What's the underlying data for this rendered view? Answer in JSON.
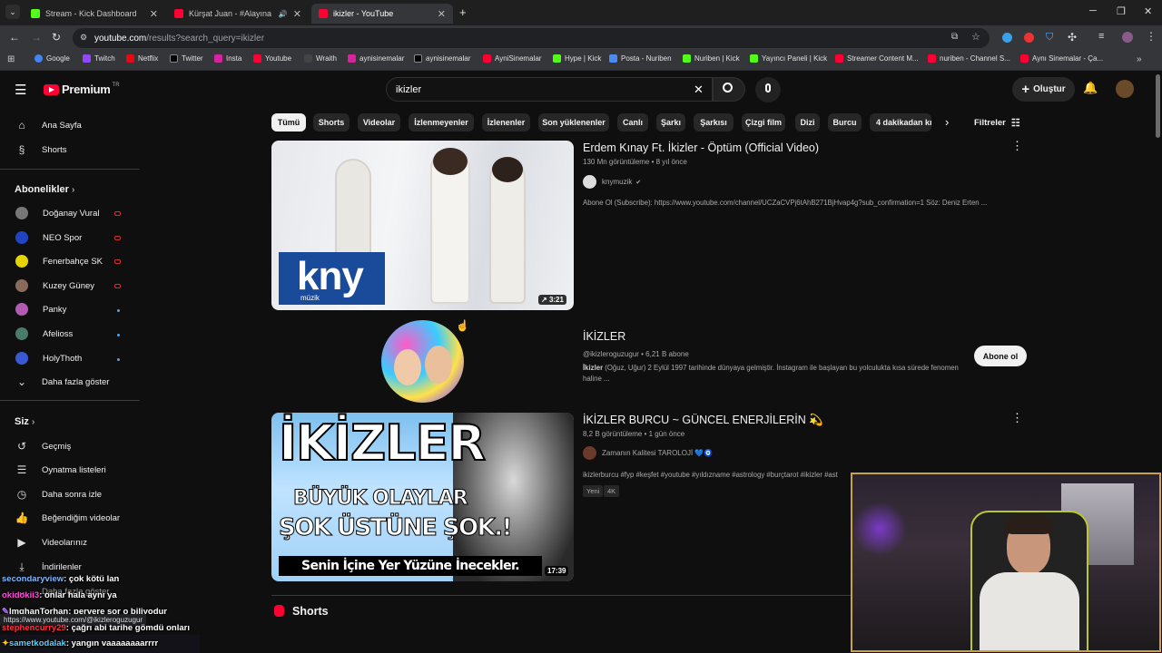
{
  "browser": {
    "tabs": [
      {
        "title": "Stream - Kick Dashboard",
        "color": "#53fc18"
      },
      {
        "title": "Kürşat Juan - #Alayına ( Offi",
        "color": "#ff0033"
      },
      {
        "title": "ikizler - YouTube",
        "color": "#ff0033"
      }
    ],
    "url_host": "youtube.com",
    "url_path": "/results?search_query=ikizler",
    "bookmarks": [
      "Google",
      "Twitch",
      "Netflix",
      "Twitter",
      "Insta",
      "Youtube",
      "Wraith",
      "aynisinemalar",
      "aynisinemalar",
      "AyniSinemalar",
      "Hype | Kick",
      "Posta - Nuriben",
      "Nuriben | Kick",
      "Yayıncı Paneli | Kick",
      "Streamer Content M...",
      "nuriben - Channel S...",
      "Aynı Sinemalar - Ça..."
    ]
  },
  "youtube": {
    "logo": "Premium",
    "logo_sup": "TR",
    "search_value": "ikizler",
    "create_label": "Oluştur",
    "sidebar": {
      "main": [
        "Ana Sayfa",
        "Shorts"
      ],
      "subs_header": "Abonelikler",
      "subs": [
        "Doğanay Vural",
        "NEO Spor",
        "Fenerbahçe SK",
        "Kuzey Güney",
        "Panky",
        "Afelioss",
        "HolyThoth"
      ],
      "show_more": "Daha fazla göster",
      "you_header": "Siz",
      "you": [
        "Geçmiş",
        "Oynatma listeleri",
        "Daha sonra izle",
        "Beğendiğim videolar",
        "Videolarınız",
        "İndirilenler",
        "Daha fazla göster"
      ]
    },
    "chips": [
      "Tümü",
      "Shorts",
      "Videolar",
      "İzlenmeyenler",
      "İzlenenler",
      "Son yüklenenler",
      "Canlı",
      "Şarkı",
      "Şarkısı",
      "Çizgi film",
      "Dizi",
      "Burcu",
      "4 dakikadan kı"
    ],
    "filters_label": "Filtreler",
    "results": {
      "video1": {
        "title": "Erdem Kınay Ft. İkizler - Öptüm (Official Video)",
        "meta": "130 Mn görüntüleme • 8 yıl önce",
        "channel": "knymuzik",
        "desc": "Abone Ol (Subscribe): https://www.youtube.com/channel/UCZaCVPj6tAhB271BjHvap4g?sub_confirmation=1 Söz: Deniz Erten ...",
        "duration": "3:21",
        "thumb_text": "kny",
        "thumb_sub": "müzik"
      },
      "channel": {
        "name": "İKİZLER",
        "meta": "@ikizleroguzugur • 6,21 B abone",
        "desc_bold": "İkizler",
        "desc": " (Oğuz, Uğur) 2 Eylül 1997 tarihinde dünyaya gelmiştir. İnstagram ile başlayan bu yolculukta kısa sürede fenomen haline ...",
        "subscribe": "Abone ol"
      },
      "video2": {
        "title": "İKİZLER BURCU ~ GÜNCEL ENERJİLERİN 💫",
        "meta": "8,2 B görüntüleme • 1 gün önce",
        "channel": "Zamanın Kalitesi TAROLOJİ 💙🧿",
        "desc": "ikizlerburcu #fyp #keşfet #youtube #yıldızname #astrology #burçtarot #ikizler #ast",
        "badges": [
          "Yeni",
          "4K"
        ],
        "duration": "17:39",
        "thumb_l1": "İKİZLER",
        "thumb_l2": "BÜYÜK OLAYLAR",
        "thumb_l3": "ŞOK ÜSTÜNE ŞOK.!",
        "thumb_l4": "Senin İçine Yer Yüzüne İnecekler."
      }
    },
    "shorts_header": "Shorts",
    "status_url": "https://www.youtube.com/@ikizleroguzugur"
  },
  "overlay_chat": [
    {
      "user": "secondaryview",
      "msg": ": çok kötü lan",
      "color": "#7ab8ff"
    },
    {
      "user": "okidokii3",
      "msg": ": onlar hala aynı ya",
      "color": "#ff4dd8"
    },
    {
      "user": "ImghanTorhan",
      "msg": ": pervere sor o biliyodur",
      "color": "#ffffff"
    },
    {
      "user": "stephencurry29",
      "msg": ": çağrı abi tarihe gömdü onları",
      "color": "#ff3344"
    },
    {
      "user": "sametkodalak",
      "msg": ": yangın vaaaaaaaarrrr",
      "color": "#5ad1ff"
    }
  ]
}
